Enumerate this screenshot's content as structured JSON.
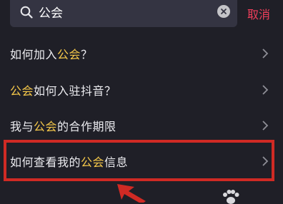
{
  "search": {
    "value": "公会",
    "cancel_label": "取消"
  },
  "results": [
    {
      "parts": [
        {
          "text": "如何加入",
          "hl": false
        },
        {
          "text": "公会",
          "hl": true
        },
        {
          "text": "？",
          "hl": false
        }
      ]
    },
    {
      "parts": [
        {
          "text": "公会",
          "hl": true
        },
        {
          "text": "如何入驻抖音？",
          "hl": false
        }
      ]
    },
    {
      "parts": [
        {
          "text": "我与",
          "hl": false
        },
        {
          "text": "公会",
          "hl": true
        },
        {
          "text": "的合作期限",
          "hl": false
        }
      ]
    },
    {
      "parts": [
        {
          "text": "如何查看我的",
          "hl": false
        },
        {
          "text": "公会",
          "hl": true
        },
        {
          "text": "信息",
          "hl": false
        }
      ]
    }
  ],
  "colors": {
    "background": "#1f1f27",
    "search_box": "#343442",
    "highlight_text": "#f5c84a",
    "cancel": "#f23f5b",
    "annotation_red": "#d02a24"
  },
  "icons": [
    "search-icon",
    "clear-icon",
    "chevron-right-icon",
    "annotation-arrow",
    "paw-icon"
  ]
}
